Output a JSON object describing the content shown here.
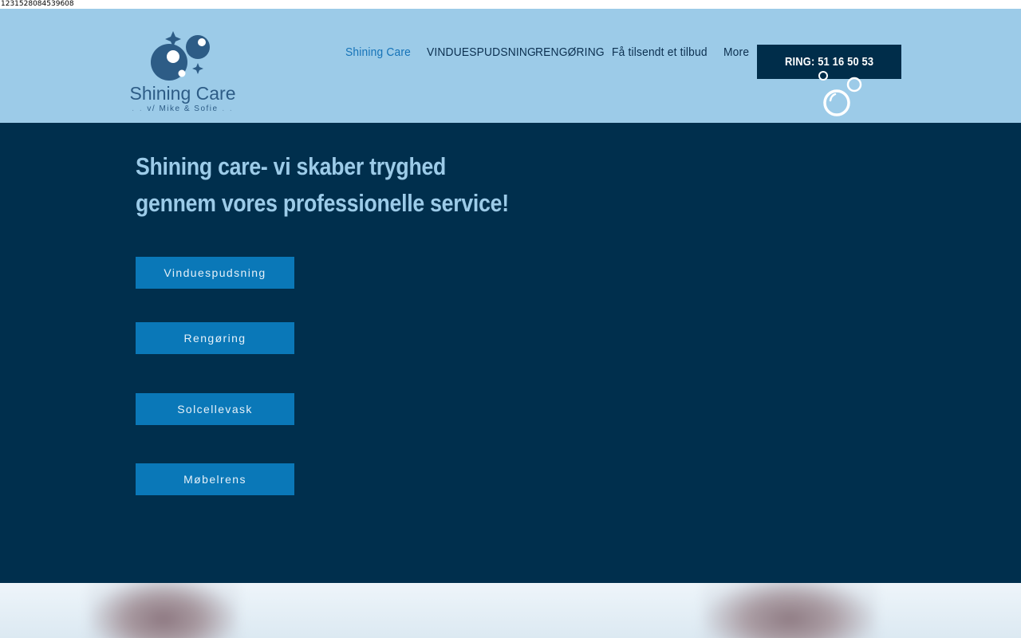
{
  "debug_text": "1231528084539608",
  "logo": {
    "name": "Shining Care",
    "subtitle": "v/ Mike & Sofie",
    "icon": "bubbles-sparkle-logo"
  },
  "nav": {
    "items": [
      {
        "label": "Shining Care",
        "active": true
      },
      {
        "label": "VINDUESPUDSNING",
        "active": false
      },
      {
        "label": "RENGØRING",
        "active": false
      },
      {
        "label": "Få tilsendt et tilbud",
        "active": false
      },
      {
        "label": "More",
        "active": false
      }
    ],
    "cta_label": "RING: 51 16 50 53"
  },
  "hero": {
    "title": "Shining care- vi skaber tryghed gennem vores professionelle service!",
    "buttons": [
      {
        "label": "Vinduespudsning"
      },
      {
        "label": "Rengøring"
      },
      {
        "label": "Solcellevask"
      },
      {
        "label": "Møbelrens"
      }
    ]
  },
  "colors": {
    "header_bg": "#9ccbe8",
    "hero_bg": "#002f4d",
    "accent": "#0a78b8",
    "nav_active": "#1573b8",
    "cta_bg": "#002d4a",
    "hero_title": "#9ccbe8"
  }
}
